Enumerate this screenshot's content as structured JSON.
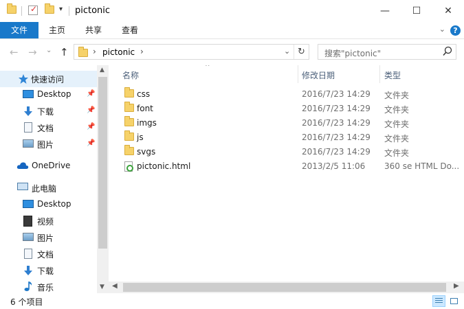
{
  "window": {
    "title": "pictonic",
    "minimize_glyph": "—",
    "maximize_glyph": "☐",
    "close_glyph": "✕"
  },
  "ribbon": {
    "tabs": [
      {
        "label": "文件"
      },
      {
        "label": "主页"
      },
      {
        "label": "共享"
      },
      {
        "label": "查看"
      }
    ],
    "help_glyph": "?",
    "expand_glyph": "⌄"
  },
  "address": {
    "path": "pictonic",
    "separator": "›",
    "search_placeholder": "搜索\"pictonic\""
  },
  "nav": {
    "back_glyph": "←",
    "forward_glyph": "→",
    "history_glyph": "⌄",
    "up_glyph": "↑",
    "dropdown_glyph": "⌄",
    "refresh_glyph": "↻",
    "quick_access": "快速访问",
    "quick_items": [
      {
        "label": "Desktop",
        "icon": "desktop-icon"
      },
      {
        "label": "下载",
        "icon": "download-icon"
      },
      {
        "label": "文档",
        "icon": "document-icon"
      },
      {
        "label": "图片",
        "icon": "pictures-icon"
      }
    ],
    "onedrive": "OneDrive",
    "this_pc": "此电脑",
    "pc_items": [
      {
        "label": "Desktop",
        "icon": "desktop-icon"
      },
      {
        "label": "视频",
        "icon": "video-icon"
      },
      {
        "label": "图片",
        "icon": "pictures-icon"
      },
      {
        "label": "文档",
        "icon": "document-icon"
      },
      {
        "label": "下载",
        "icon": "download-icon"
      },
      {
        "label": "音乐",
        "icon": "music-icon"
      }
    ]
  },
  "columns": {
    "name": "名称",
    "date": "修改日期",
    "type": "类型"
  },
  "files": [
    {
      "name": "css",
      "date": "2016/7/23 14:29",
      "type": "文件夹",
      "kind": "folder"
    },
    {
      "name": "font",
      "date": "2016/7/23 14:29",
      "type": "文件夹",
      "kind": "folder"
    },
    {
      "name": "imgs",
      "date": "2016/7/23 14:29",
      "type": "文件夹",
      "kind": "folder"
    },
    {
      "name": "js",
      "date": "2016/7/23 14:29",
      "type": "文件夹",
      "kind": "folder"
    },
    {
      "name": "svgs",
      "date": "2016/7/23 14:29",
      "type": "文件夹",
      "kind": "folder"
    },
    {
      "name": "pictonic.html",
      "date": "2013/2/5 11:06",
      "type": "360 se HTML Do...",
      "kind": "html"
    }
  ],
  "status": {
    "item_count": "6 个项目"
  },
  "colors": {
    "file_tab": "#1979ca",
    "selection": "#e5f1fb",
    "folder": "#f6d26a"
  }
}
